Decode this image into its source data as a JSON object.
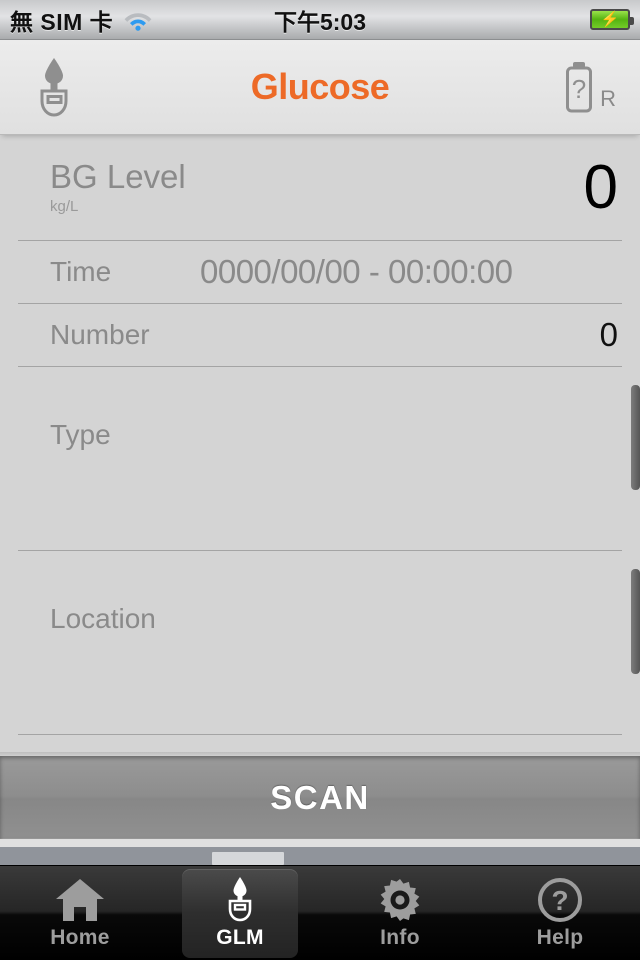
{
  "status_bar": {
    "carrier": "無 SIM 卡",
    "wifi_icon": "wifi-icon",
    "time": "下午5:03",
    "battery_icon": "battery-charging-icon"
  },
  "nav_bar": {
    "left_icon": "glucose-meter-icon",
    "title": "Glucose",
    "title_color": "#ED6A27",
    "right_icon": "battery-unknown-icon",
    "right_label": "R"
  },
  "readings": {
    "bg_level": {
      "label": "BG Level",
      "unit": "kg/L",
      "value": "0"
    },
    "time": {
      "label": "Time",
      "value": "0000/00/00 - 00:00:00"
    },
    "number": {
      "label": "Number",
      "value": "0"
    },
    "type": {
      "label": "Type",
      "value": ""
    },
    "location": {
      "label": "Location",
      "value": ""
    }
  },
  "scan": {
    "label": "SCAN"
  },
  "tab_bar": {
    "tabs": [
      {
        "label": "Home",
        "icon": "home-icon",
        "selected": false
      },
      {
        "label": "GLM",
        "icon": "glucose-meter-icon",
        "selected": true
      },
      {
        "label": "Info",
        "icon": "gear-icon",
        "selected": false
      },
      {
        "label": "Help",
        "icon": "question-circle-icon",
        "selected": false
      }
    ]
  }
}
